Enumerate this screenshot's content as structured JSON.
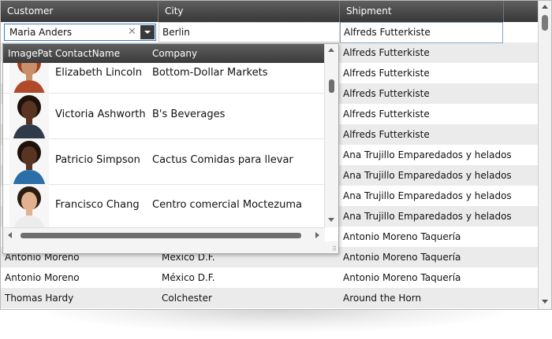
{
  "columns": {
    "customer": "Customer",
    "city": "City",
    "shipment": "Shipment"
  },
  "edit_row": {
    "customer_value": "Maria Anders",
    "city_value": "Berlin",
    "shipment_value": "Alfreds Futterkiste"
  },
  "popup": {
    "columns": {
      "image": "ImagePat",
      "contact": "ContactName",
      "company": "Company"
    },
    "rows": [
      {
        "contact": "Elizabeth Lincoln",
        "company": "Bottom-Dollar Markets",
        "image_icon": "person-photo-icon"
      },
      {
        "contact": "Victoria Ashworth",
        "company": "B's Beverages",
        "image_icon": "person-photo-icon"
      },
      {
        "contact": "Patricio Simpson",
        "company": "Cactus Comidas para llevar",
        "image_icon": "person-photo-icon"
      },
      {
        "contact": "Francisco Chang",
        "company": "Centro comercial Moctezuma",
        "image_icon": "person-photo-icon"
      }
    ]
  },
  "rows": [
    {
      "customer": "",
      "city": "",
      "shipment": "Alfreds Futterkiste"
    },
    {
      "customer": "",
      "city": "",
      "shipment": "Alfreds Futterkiste"
    },
    {
      "customer": "",
      "city": "",
      "shipment": "Alfreds Futterkiste"
    },
    {
      "customer": "",
      "city": "",
      "shipment": "Alfreds Futterkiste"
    },
    {
      "customer": "",
      "city": "",
      "shipment": "Alfreds Futterkiste"
    },
    {
      "customer": "",
      "city": "",
      "shipment": "Ana Trujillo Emparedados y helados"
    },
    {
      "customer": "",
      "city": "",
      "shipment": "Ana Trujillo Emparedados y helados"
    },
    {
      "customer": "",
      "city": "",
      "shipment": "Ana Trujillo Emparedados y helados"
    },
    {
      "customer": "",
      "city": "",
      "shipment": "Ana Trujillo Emparedados y helados"
    },
    {
      "customer": "",
      "city": "",
      "shipment": "Antonio Moreno Taquería"
    },
    {
      "customer": "Antonio Moreno",
      "city": "México D.F.",
      "shipment": "Antonio Moreno Taquería"
    },
    {
      "customer": "Antonio Moreno",
      "city": "México D.F.",
      "shipment": "Antonio Moreno Taquería"
    },
    {
      "customer": "Thomas Hardy",
      "city": "Colchester",
      "shipment": "Around the Horn"
    }
  ],
  "colors": {
    "header": "#3f3f3f",
    "alt_row": "#ebebeb",
    "focus_border": "#3d7fc4"
  }
}
